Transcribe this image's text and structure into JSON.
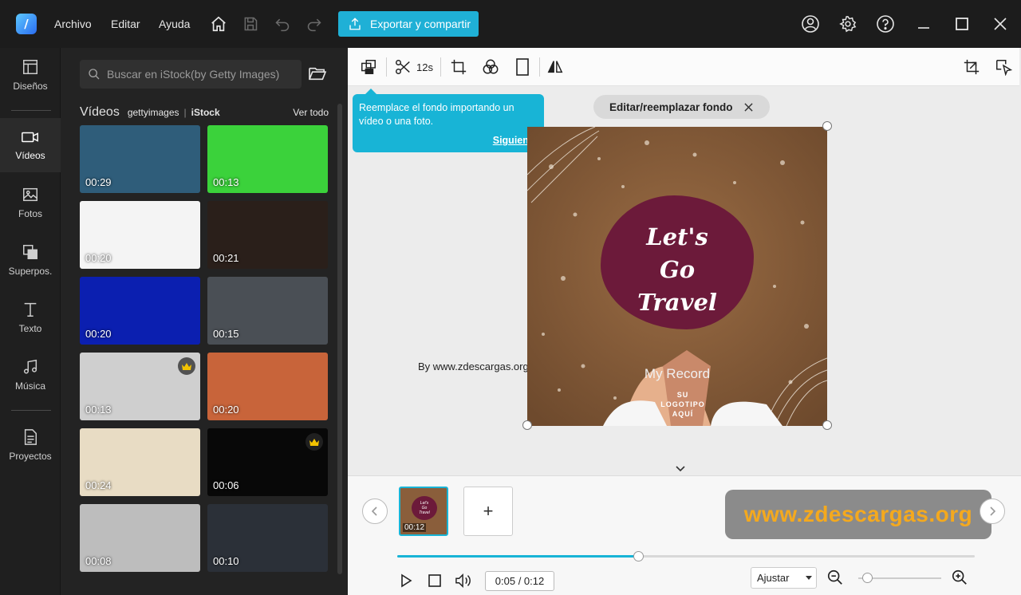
{
  "app": {
    "menu": [
      "Archivo",
      "Editar",
      "Ayuda"
    ],
    "export_label": "Exportar y compartir"
  },
  "rail": {
    "items": [
      {
        "label": "Diseños",
        "icon": "layout-icon"
      },
      {
        "label": "Vídeos",
        "icon": "video-camera-icon",
        "active": true
      },
      {
        "label": "Fotos",
        "icon": "image-icon"
      },
      {
        "label": "Superpos.",
        "icon": "overlay-icon"
      },
      {
        "label": "Texto",
        "icon": "text-icon"
      },
      {
        "label": "Música",
        "icon": "music-note-icon"
      },
      {
        "label": "Proyectos",
        "icon": "document-icon"
      }
    ]
  },
  "media": {
    "search_placeholder": "Buscar en iStock(by Getty Images)",
    "section_title": "Vídeos",
    "brand_getty": "gettyimages",
    "brand_istock": "iStock",
    "view_all": "Ver todo",
    "thumbnails": [
      {
        "duration": "00:29",
        "bg": "#2f5d7a",
        "premium": false
      },
      {
        "duration": "00:13",
        "bg": "#3bd23b",
        "premium": false
      },
      {
        "duration": "00:20",
        "bg": "#f4f4f4",
        "premium": false
      },
      {
        "duration": "00:21",
        "bg": "#2a1f1a",
        "premium": false
      },
      {
        "duration": "00:20",
        "bg": "#0b1fb0",
        "premium": false
      },
      {
        "duration": "00:15",
        "bg": "#4a4f55",
        "premium": false
      },
      {
        "duration": "00:13",
        "bg": "#cfcfcf",
        "premium": true
      },
      {
        "duration": "00:20",
        "bg": "#c8643a",
        "premium": false
      },
      {
        "duration": "00:24",
        "bg": "#e8dcc4",
        "premium": false
      },
      {
        "duration": "00:06",
        "bg": "#080808",
        "premium": true
      },
      {
        "duration": "00:08",
        "bg": "#bdbdbd",
        "premium": false
      },
      {
        "duration": "00:10",
        "bg": "#2b3038",
        "premium": false
      }
    ]
  },
  "editor": {
    "split_duration": "12s",
    "tooltip_text": "Reemplace el fondo importando un vídeo o una foto.",
    "tooltip_next": "Siguiente",
    "bg_pill_label": "Editar/reemplazar fondo",
    "canvas_title_lines": [
      "Let's",
      "Go",
      "Travel"
    ],
    "canvas_brand": "My Record",
    "canvas_logo_lines": [
      "SU",
      "LOGOTIPO",
      "AQUÍ"
    ],
    "watermark": "By www.zdescargas.org"
  },
  "timeline": {
    "clip_duration": "00:12",
    "add_label": "+",
    "banner": "www.zdescargas.org",
    "current_time": "0:05",
    "total_time": "0:12",
    "progress": 0.417,
    "fit_label": "Ajustar",
    "zoom_level": 0.05
  }
}
